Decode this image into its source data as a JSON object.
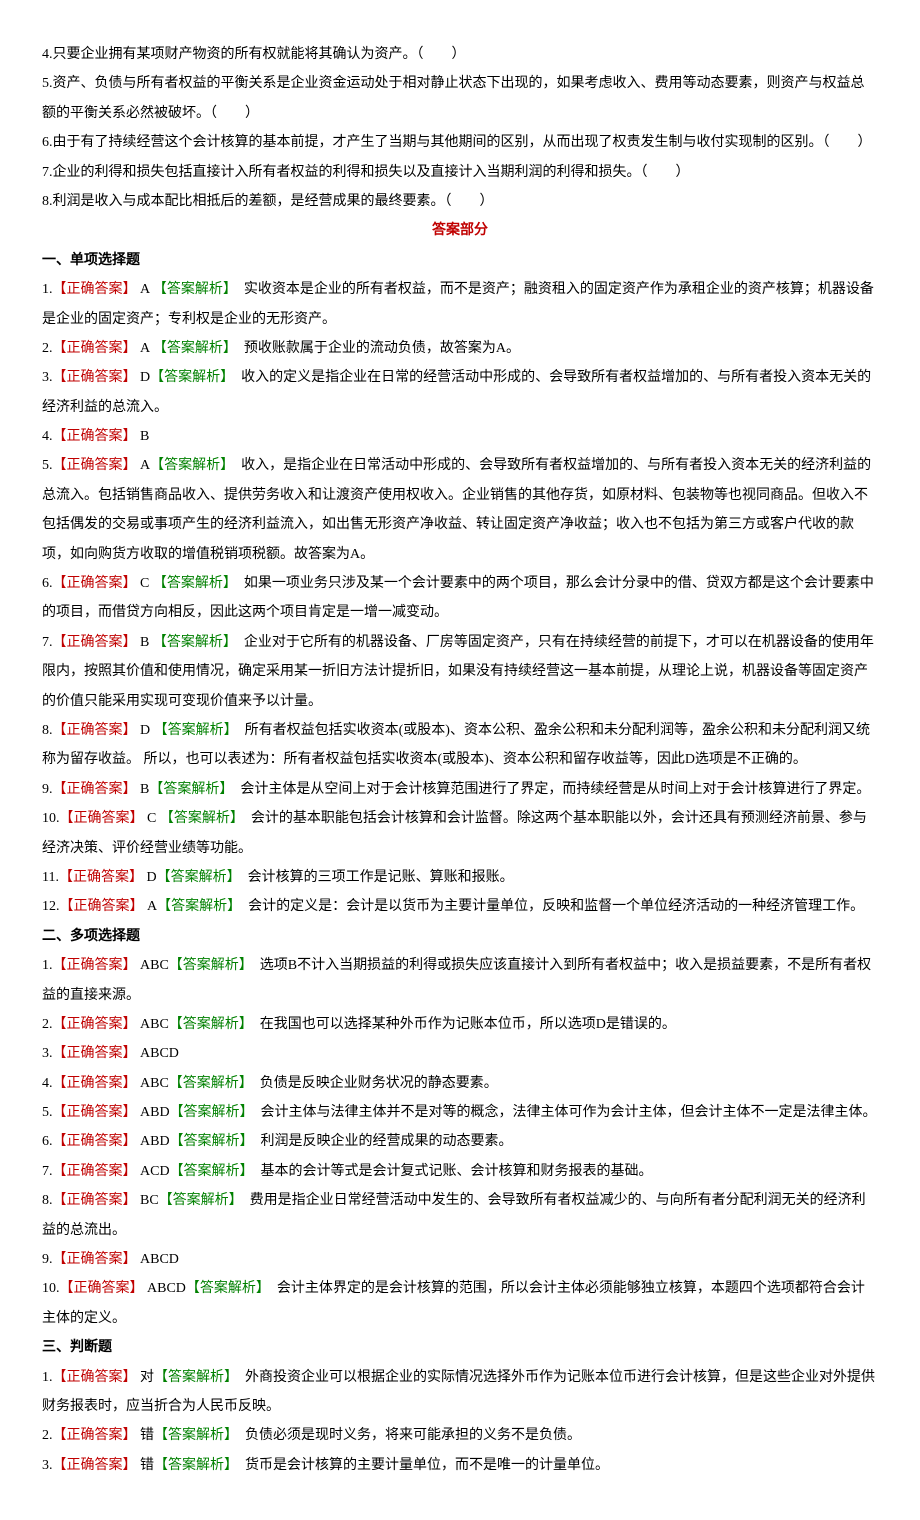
{
  "top_questions": [
    "4.只要企业拥有某项财产物资的所有权就能将其确认为资产。（　　）",
    "5.资产、负债与所有者权益的平衡关系是企业资金运动处于相对静止状态下出现的，如果考虑收入、费用等动态要素，则资产与权益总额的平衡关系必然被破坏。（　　）",
    "6.由于有了持续经营这个会计核算的基本前提，才产生了当期与其他期间的区别，从而出现了权责发生制与收付实现制的区别。（　　）",
    "7.企业的利得和损失包括直接计入所有者权益的利得和损失以及直接计入当期利润的利得和损失。（　　）",
    "8.利润是收入与成本配比相抵后的差额，是经营成果的最终要素。（　　）"
  ],
  "answer_header": "答案部分",
  "section1": {
    "title": "一、单项选择题",
    "items": [
      {
        "num": "1",
        "ans": " A ",
        "gap": "  ",
        "exp": "实收资本是企业的所有者权益，而不是资产；融资租入的固定资产作为承租企业的资产核算；机器设备是企业的固定资产；专利权是企业的无形资产。"
      },
      {
        "num": "2",
        "ans": " A ",
        "gap": "    ",
        "exp": "预收账款属于企业的流动负债，故答案为A。"
      },
      {
        "num": "3",
        "ans": " D",
        "gap": "",
        "exp": "收入的定义是指企业在日常的经营活动中形成的、会导致所有者权益增加的、与所有者投入资本无关的经济利益的总流入。"
      },
      {
        "num": "4",
        "ans": " B",
        "gap": null,
        "exp": null
      },
      {
        "num": "5",
        "ans": " A",
        "gap": "",
        "exp": "收入，是指企业在日常活动中形成的、会导致所有者权益增加的、与所有者投入资本无关的经济利益的总流入。包括销售商品收入、提供劳务收入和让渡资产使用权收入。企业销售的其他存货，如原材料、包装物等也视同商品。但收入不包括偶发的交易或事项产生的经济利益流入，如出售无形资产净收益、转让固定资产净收益；收入也不包括为第三方或客户代收的款项，如向购货方收取的增值税销项税额。故答案为A。"
      },
      {
        "num": "6",
        "ans": " C ",
        "gap": "  ",
        "exp": "如果一项业务只涉及某一个会计要素中的两个项目，那么会计分录中的借、贷双方都是这个会计要素中的项目，而借贷方向相反，因此这两个项目肯定是一增一减变动。"
      },
      {
        "num": "7",
        "ans": " B ",
        "gap": "  ",
        "exp": "企业对于它所有的机器设备、厂房等固定资产，只有在持续经营的前提下，才可以在机器设备的使用年限内，按照其价值和使用情况，确定采用某一折旧方法计提折旧，如果没有持续经营这一基本前提，从理论上说，机器设备等固定资产的价值只能采用实现可变现价值来予以计量。"
      },
      {
        "num": "8",
        "ans": " D ",
        "gap": "  ",
        "exp": "所有者权益包括实收资本(或股本)、资本公积、盈余公积和未分配利润等，盈余公积和未分配利润又统称为留存收益。 所以，也可以表述为：所有者权益包括实收资本(或股本)、资本公积和留存收益等，因此D选项是不正确的。"
      },
      {
        "num": "9",
        "ans": " B",
        "gap": "",
        "exp": "会计主体是从空间上对于会计核算范围进行了界定，而持续经营是从时间上对于会计核算进行了界定。"
      },
      {
        "num": "10",
        "ans": " C ",
        "gap": "  ",
        "exp": "会计的基本职能包括会计核算和会计监督。除这两个基本职能以外，会计还具有预测经济前景、参与经济决策、评价经营业绩等功能。"
      },
      {
        "num": "11",
        "ans": " D",
        "gap": "",
        "exp": "会计核算的三项工作是记账、算账和报账。"
      },
      {
        "num": "12",
        "ans": " A",
        "gap": "",
        "exp": "会计的定义是：会计是以货币为主要计量单位，反映和监督一个单位经济活动的一种经济管理工作。"
      }
    ]
  },
  "section2": {
    "title": "二、多项选择题",
    "items": [
      {
        "num": "1",
        "ans": " ABC",
        "exp": "选项B不计入当期损益的利得或损失应该直接计入到所有者权益中；收入是损益要素，不是所有者权益的直接来源。"
      },
      {
        "num": "2",
        "ans": " ABC",
        "exp": "在我国也可以选择某种外币作为记账本位币，所以选项D是错误的。"
      },
      {
        "num": "3",
        "ans": " ABCD",
        "exp": null
      },
      {
        "num": "4",
        "ans": " ABC",
        "exp": "负债是反映企业财务状况的静态要素。"
      },
      {
        "num": "5",
        "ans": " ABD",
        "exp": "会计主体与法律主体并不是对等的概念，法律主体可作为会计主体，但会计主体不一定是法律主体。"
      },
      {
        "num": "6",
        "ans": " ABD",
        "exp": "利润是反映企业的经营成果的动态要素。"
      },
      {
        "num": "7",
        "ans": " ACD",
        "exp": "基本的会计等式是会计复式记账、会计核算和财务报表的基础。"
      },
      {
        "num": "8",
        "ans": " BC",
        "exp": "费用是指企业日常经营活动中发生的、会导致所有者权益减少的、与向所有者分配利润无关的经济利益的总流出。"
      },
      {
        "num": "9",
        "ans": " ABCD",
        "exp": null
      },
      {
        "num": "10",
        "ans": " ABCD",
        "exp": "会计主体界定的是会计核算的范围，所以会计主体必须能够独立核算，本题四个选项都符合会计主体的定义。"
      }
    ]
  },
  "section3": {
    "title": "三、判断题",
    "items": [
      {
        "num": "1",
        "ans": " 对",
        "exp": "外商投资企业可以根据企业的实际情况选择外币作为记账本位币进行会计核算，但是这些企业对外提供财务报表时，应当折合为人民币反映。"
      },
      {
        "num": "2",
        "ans": " 错",
        "exp": "负债必须是现时义务，将来可能承担的义务不是负债。"
      },
      {
        "num": "3",
        "ans": " 错",
        "exp": "货币是会计核算的主要计量单位，而不是唯一的计量单位。"
      }
    ]
  },
  "labels": {
    "correct": "正确答案",
    "explain": "答案解析"
  }
}
